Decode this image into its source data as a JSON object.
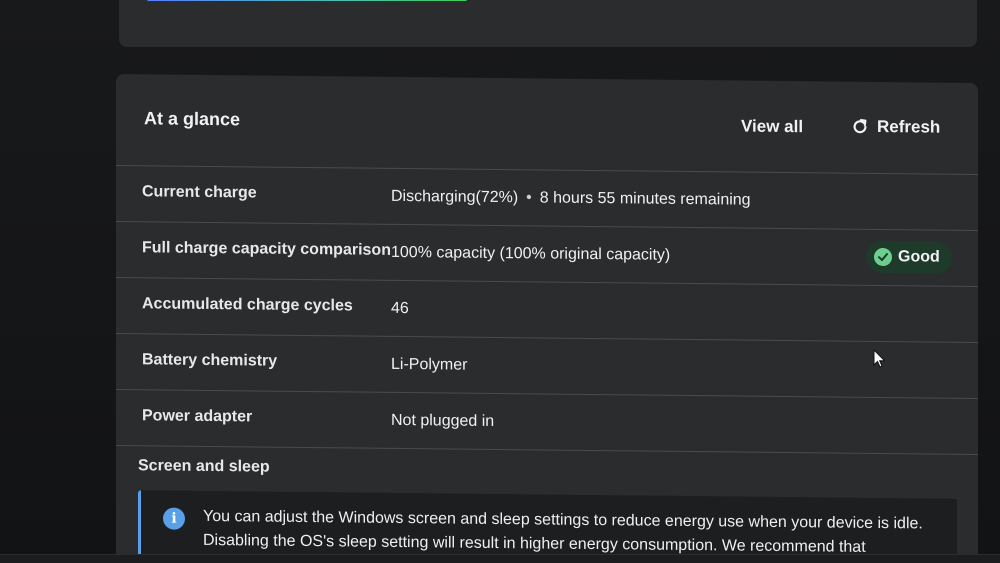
{
  "header": {
    "title": "At a glance",
    "view_all_label": "View all",
    "refresh_label": "Refresh"
  },
  "rows": [
    {
      "label": "Current charge",
      "value": "Discharging(72%)",
      "value_suffix": "8 hours 55 minutes remaining"
    },
    {
      "label": "Full charge capacity comparison",
      "value": "100% capacity (100% original capacity)",
      "badge": "Good"
    },
    {
      "label": "Accumulated charge cycles",
      "value": "46"
    },
    {
      "label": "Battery chemistry",
      "value": "Li-Polymer"
    },
    {
      "label": "Power adapter",
      "value": "Not plugged in"
    }
  ],
  "screen_sleep": {
    "title": "Screen and sleep",
    "info_text": "You can adjust the Windows screen and sleep settings to reduce energy use when your device is idle. Disabling the OS's sleep setting will result in higher energy consumption. We recommend that"
  },
  "colors": {
    "card_bg": "#2b2c2e",
    "divider": "#4a4b4e",
    "good_badge_bg": "#1e3a2b",
    "good_check": "#6ccf8e",
    "info_accent": "#5aa0e8"
  },
  "icons": {
    "refresh": "refresh-icon",
    "good": "check-circle-icon",
    "info": "info-icon"
  }
}
